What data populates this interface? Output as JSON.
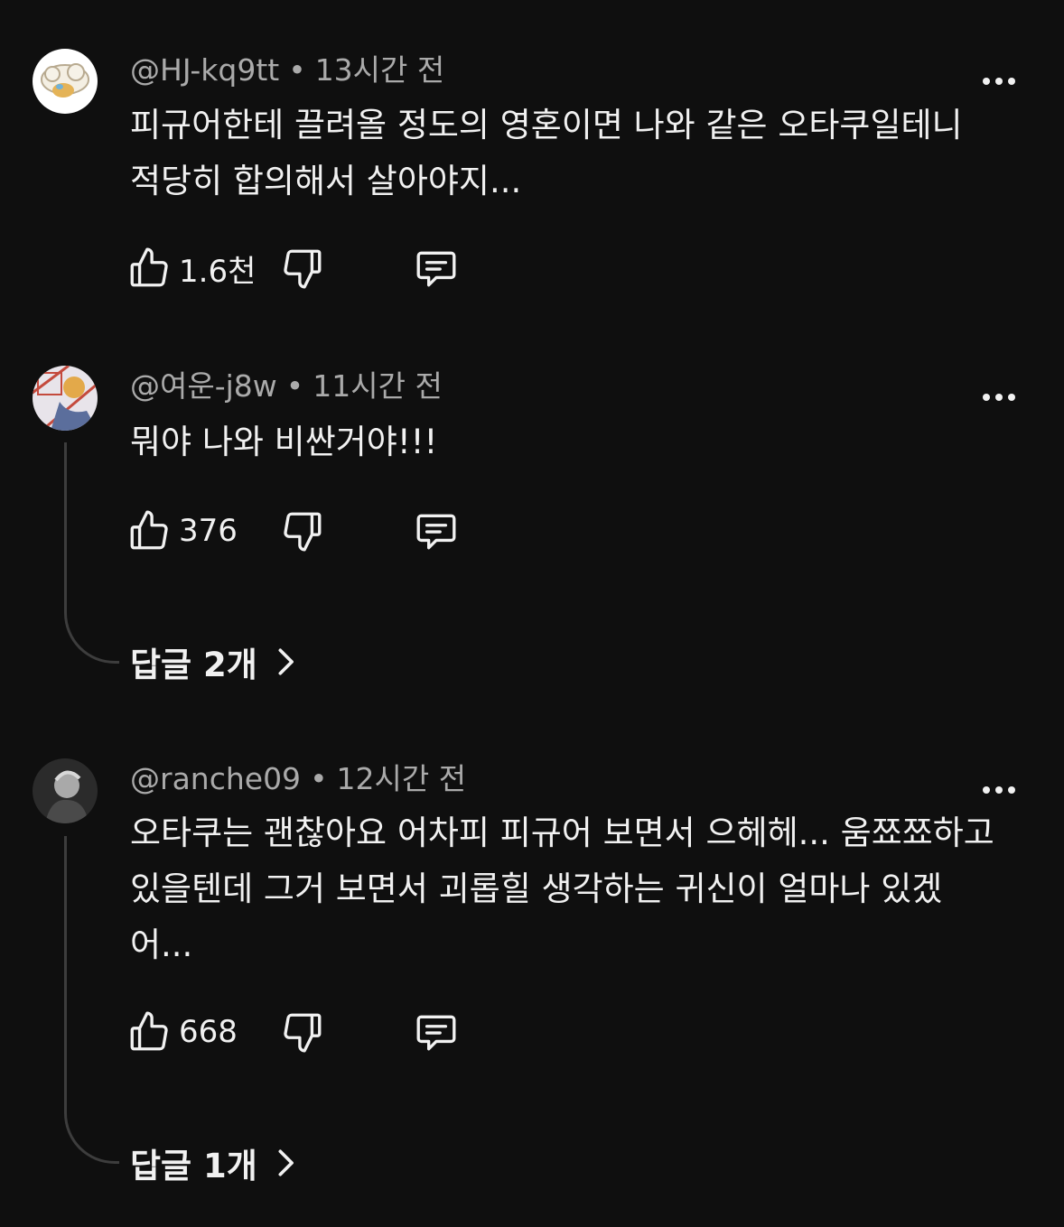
{
  "comments": [
    {
      "author": "@HJ-kq9tt",
      "time": "13시간 전",
      "text": "피규어한테 끌려올 정도의 영혼이면 나와 같은 오타쿠일테니 적당히 합의해서 살아야지...",
      "likes": "1.6천",
      "avatar_colors": [
        "#f4efe3",
        "#e4b357"
      ]
    },
    {
      "author": "@여운-j8w",
      "time": "11시간 전",
      "text": "뭐야 나와 비싼거야!!!",
      "likes": "376",
      "replies_label": "답글 2개",
      "avatar_colors": [
        "#e8e4ea",
        "#c44a3d"
      ]
    },
    {
      "author": "@ranche09",
      "time": "12시간 전",
      "text": "오타쿠는 괜찮아요 어차피 피규어 보면서 으헤헤... 움쬬쬬하고 있을텐데 그거 보면서 괴롭힐 생각하는 귀신이 얼마나 있겠어...",
      "likes": "668",
      "replies_label": "답글 1개",
      "avatar_colors": [
        "#3a3a3a",
        "#a9a9a9"
      ]
    }
  ],
  "separator": "•",
  "icons": {
    "like": "thumbs-up-icon",
    "dislike": "thumbs-down-icon",
    "reply": "comment-icon",
    "menu": "more-dots-icon",
    "expand": "chevron-right-icon"
  },
  "colors": {
    "background": "#0f0f0f",
    "text": "#f1f1f1",
    "meta": "#aaaaaa",
    "thread": "#3d3d3d"
  }
}
